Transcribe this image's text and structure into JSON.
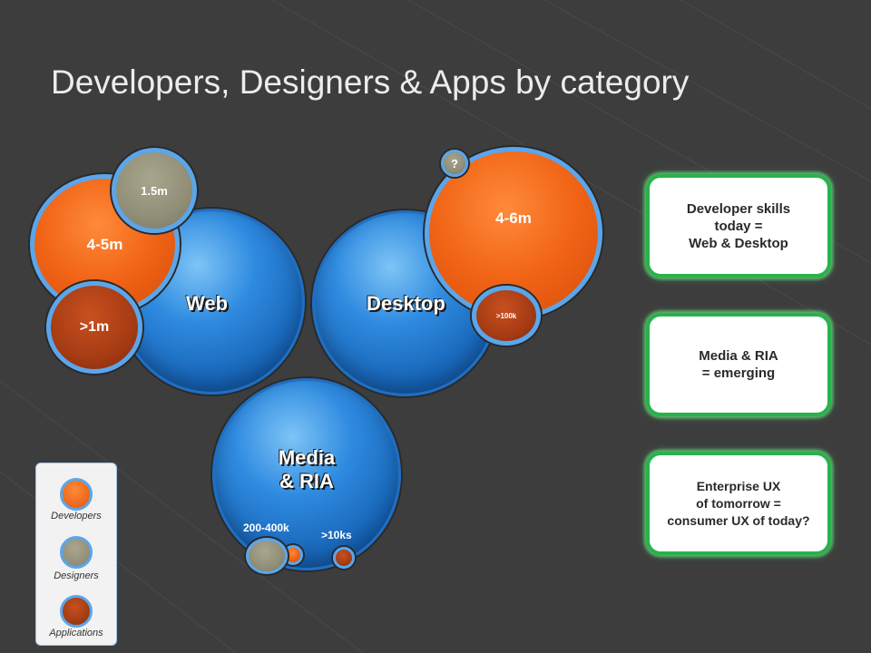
{
  "title": "Developers, Designers & Apps by category",
  "colors": {
    "background": "#3d3d3d",
    "platform_blue": "#2f8be0",
    "developers_orange": "#f16416",
    "applications_rust": "#a63b14",
    "designers_gray": "#918e77",
    "card_border_green": "#27b34a",
    "ring_blue": "#5aa6ec"
  },
  "bubbles": {
    "web": {
      "label": "Web",
      "developers": "4-5m",
      "designers": "1.5m",
      "applications": ">1m"
    },
    "desktop": {
      "label": "Desktop",
      "developers": "4-6m",
      "designers": "?",
      "applications": ">100k"
    },
    "media": {
      "label_line1": "Media",
      "label_line2": "& RIA",
      "developers": "200-400k",
      "applications": ">10ks"
    }
  },
  "cards": [
    {
      "lines": [
        "Developer skills",
        "today =",
        "Web & Desktop"
      ]
    },
    {
      "lines": [
        "Media & RIA",
        "= emerging"
      ]
    },
    {
      "lines": [
        "Enterprise UX",
        "of tomorrow =",
        "consumer UX of today?"
      ]
    }
  ],
  "legend": {
    "developers": "Developers",
    "designers": "Designers",
    "applications": "Applications"
  }
}
